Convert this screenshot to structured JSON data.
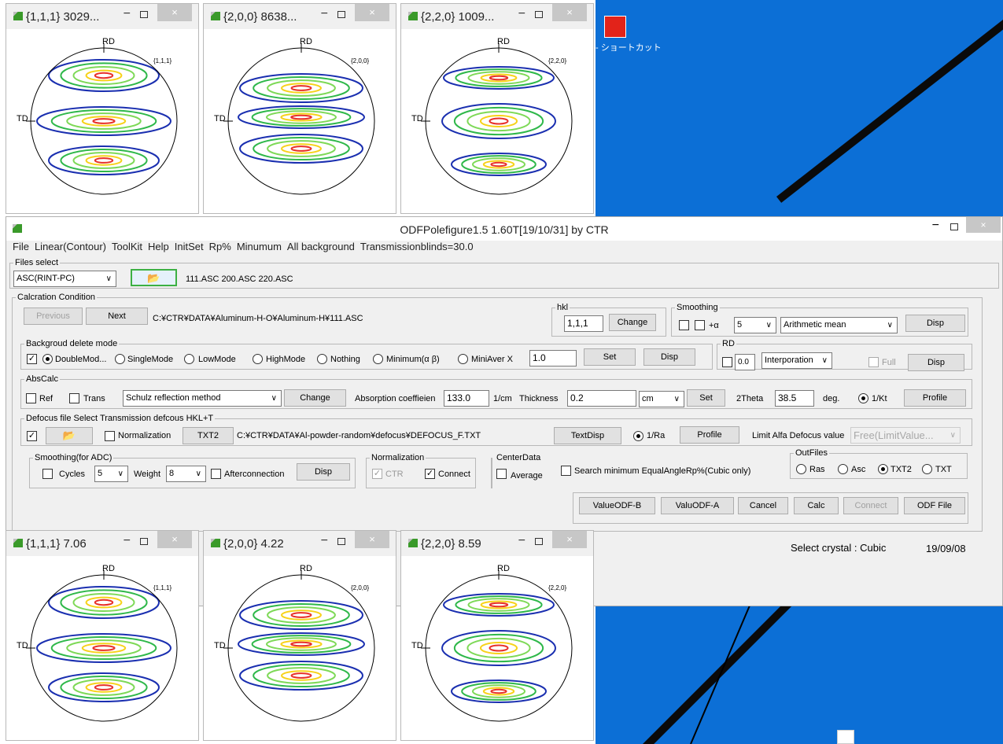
{
  "desktop": {
    "icon_label": "- ショートカット"
  },
  "pole_windows": [
    {
      "title": "{1,1,1} 3029...",
      "hkl": "{1,1,1}",
      "rd": "RD",
      "td": "TD",
      "min": "−",
      "close": "×"
    },
    {
      "title": "{2,0,0} 8638...",
      "hkl": "{2,0,0}",
      "rd": "RD",
      "td": "TD",
      "min": "−",
      "close": "×"
    },
    {
      "title": "{2,2,0} 1009...",
      "hkl": "{2,2,0}",
      "rd": "RD",
      "td": "TD",
      "min": "−",
      "close": "×"
    },
    {
      "title": "{1,1,1} 7.06",
      "hkl": "{1,1,1}",
      "rd": "RD",
      "td": "TD",
      "min": "−",
      "close": "×"
    },
    {
      "title": "{2,0,0} 4.22",
      "hkl": "{2,0,0}",
      "rd": "RD",
      "td": "TD",
      "min": "−",
      "close": "×"
    },
    {
      "title": "{2,2,0} 8.59",
      "hkl": "{2,2,0}",
      "rd": "RD",
      "td": "TD",
      "min": "−",
      "close": "×"
    }
  ],
  "main": {
    "title": "ODFPolefigure1.5 1.60T[19/10/31] by CTR",
    "min": "−",
    "close": "×",
    "menu": [
      "File",
      "Linear(Contour)",
      "ToolKit",
      "Help",
      "InitSet",
      "Rp%",
      "Minumum",
      "All background",
      "Transmissionblinds=30.0"
    ],
    "files": {
      "legend": "Files select",
      "format": "ASC(RINT-PC)",
      "folder_icon": "📂",
      "files": "111.ASC 200.ASC 220.ASC"
    },
    "calc": {
      "legend": "Calcration Condition",
      "previous": "Previous",
      "next": "Next",
      "path": "C:¥CTR¥DATA¥Aluminum-H-O¥Aluminum-H¥111.ASC",
      "hkl_legend": "hkl",
      "hkl_value": "1,1,1",
      "change": "Change",
      "smoothing_legend": "Smoothing",
      "alpha_label": "+α",
      "smooth_n": "5",
      "smooth_method": "Arithmetic mean",
      "disp": "Disp"
    },
    "bg": {
      "legend": "Backgroud delete mode",
      "check": "✓",
      "modes": [
        "DoubleMod...",
        "SingleMode",
        "LowMode",
        "HighMode",
        "Nothing",
        "Minimum(α β)",
        "MiniAver X"
      ],
      "value": "1.0",
      "set": "Set",
      "disp": "Disp",
      "rd_legend": "RD",
      "rd_value": "0.0",
      "interp": "Interporation",
      "full": "Full",
      "rd_disp": "Disp"
    },
    "abs": {
      "legend": "AbsCalc",
      "ref": "Ref",
      "trans": "Trans",
      "method": "Schulz reflection method",
      "change": "Change",
      "coef_label": "Absorption coeffieien",
      "coef": "133.0",
      "coef_unit": "1/cm",
      "thick_label": "Thickness",
      "thick": "0.2",
      "thick_unit": "cm",
      "set": "Set",
      "theta_label": "2Theta",
      "theta": "38.5",
      "deg": "deg.",
      "kt": "1/Kt",
      "profile": "Profile"
    },
    "defocus": {
      "legend": "Defocus file Select Transmission defcous HKL+T",
      "check": "✓",
      "folder_icon": "📂",
      "normalization": "Normalization",
      "txt2": "TXT2",
      "path": "C:¥CTR¥DATA¥Al-powder-random¥defocus¥DEFOCUS_F.TXT",
      "textdisp": "TextDisp",
      "ra": "1/Ra",
      "profile": "Profile",
      "limit_label": "Limit Alfa Defocus value",
      "limit_value": "Free(LimitValue..."
    },
    "adc": {
      "legend": "Smoothing(for ADC)",
      "cycles": "Cycles",
      "cycles_n": "5",
      "weight": "Weight",
      "weight_n": "8",
      "after": "Afterconnection",
      "disp": "Disp"
    },
    "norm": {
      "legend": "Normalization",
      "ctr": "CTR",
      "connect": "Connect",
      "check": "✓"
    },
    "center": {
      "legend": "CenterData",
      "average": "Average"
    },
    "search": "Search minimum EqualAngleRp%(Cubic only)",
    "outfiles": {
      "legend": "OutFiles",
      "options": [
        "Ras",
        "Asc",
        "TXT2",
        "TXT"
      ]
    },
    "actions": [
      "ValueODF-B",
      "ValuODF-A",
      "Cancel",
      "Calc",
      "Connect",
      "ODF File"
    ],
    "status": {
      "crystal": "Select crystal : Cubic",
      "date": "19/09/08"
    }
  }
}
